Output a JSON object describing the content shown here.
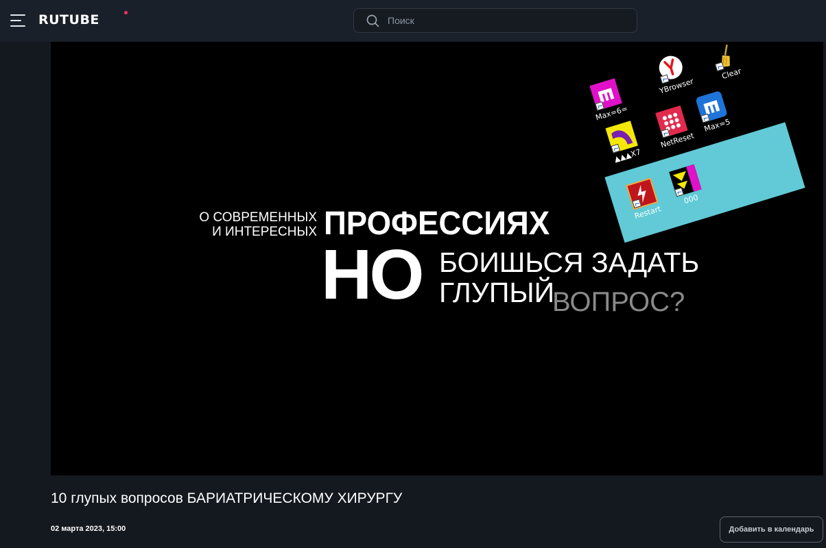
{
  "header": {
    "logo_text": "RUTUBE",
    "logo_dot_color": "#ff2f5f",
    "menu_icon": "hamburger-icon",
    "search_icon": "search-icon",
    "search_placeholder": "Поиск"
  },
  "video": {
    "thumbnail_text": {
      "line1": "О СОВРЕМЕННЫХ",
      "line2": "И ИНТЕРЕСНЫХ",
      "big1": "ПРОФЕССИЯХ",
      "big2": "НО",
      "line3": "БОИШЬСЯ ЗАДАТЬ",
      "line4": "ГЛУПЫЙ",
      "line5": "ВОПРОС?"
    },
    "desktop_icons": [
      {
        "label": "Max=6=",
        "icon": "maxthon-icon"
      },
      {
        "label": "YBrowser",
        "icon": "yandex-browser-icon"
      },
      {
        "label": "Clear",
        "icon": "broom-icon"
      },
      {
        "label": "▲▲▲X7",
        "icon": "app-x7-icon"
      },
      {
        "label": "NetReset",
        "icon": "net-reset-icon"
      },
      {
        "label": "Max=5",
        "icon": "maxthon-blue-icon"
      },
      {
        "label": "Restart",
        "icon": "restart-icon"
      },
      {
        "label": "000",
        "icon": "app-000-icon"
      }
    ]
  },
  "details": {
    "title": "10 глупых вопросов БАРИАТРИЧЕСКОМУ ХИРУРГУ",
    "date": "02 марта 2023, 15:00",
    "calendar_button": "Добавить в календарь"
  },
  "colors": {
    "page_bg": "#14191f",
    "header_bg": "#1a2029",
    "desktop_panel": "#61cad6"
  }
}
